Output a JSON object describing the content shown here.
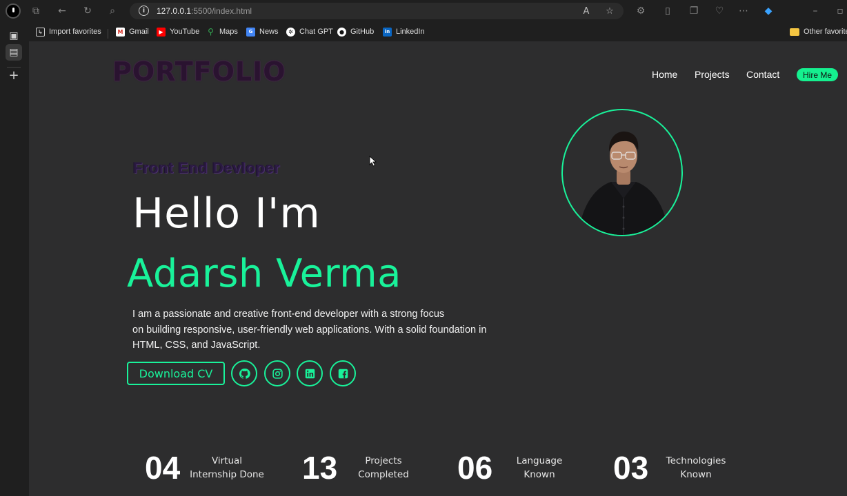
{
  "browser": {
    "url_host": "127.0.0.1",
    "url_rest": ":5500/index.html",
    "bookmarks": [
      {
        "label": "Import favorites",
        "icon": "import-icon"
      },
      {
        "label": "Gmail",
        "icon": "gmail-icon"
      },
      {
        "label": "YouTube",
        "icon": "youtube-icon"
      },
      {
        "label": "Maps",
        "icon": "maps-icon"
      },
      {
        "label": "News",
        "icon": "news-icon"
      },
      {
        "label": "Chat GPT",
        "icon": "chatgpt-icon"
      },
      {
        "label": "GitHub",
        "icon": "github-icon"
      },
      {
        "label": "LinkedIn",
        "icon": "linkedin-icon"
      }
    ],
    "other_favorites": "Other favorites"
  },
  "header": {
    "logo": "PORTFOLIO",
    "nav": [
      "Home",
      "Projects",
      "Contact"
    ],
    "hire_label": "Hire Me"
  },
  "hero": {
    "role": "Front End Devloper",
    "greeting": "Hello I'm",
    "name": "Adarsh Verma",
    "description_lines": [
      "I am a passionate and creative front-end developer with a strong focus",
      "on building responsive, user-friendly web applications. With a solid foundation in",
      "HTML, CSS, and JavaScript."
    ],
    "cv_label": "Download CV",
    "socials": [
      "github-icon",
      "instagram-icon",
      "linkedin-icon",
      "facebook-icon"
    ]
  },
  "stats": [
    {
      "number": "04",
      "label_lines": [
        "Virtual",
        "Internship Done"
      ]
    },
    {
      "number": "13",
      "label_lines": [
        "Projects",
        "Completed"
      ]
    },
    {
      "number": "06",
      "label_lines": [
        "Language",
        "Known"
      ]
    },
    {
      "number": "03",
      "label_lines": [
        "Technologies",
        "Known"
      ]
    }
  ],
  "colors": {
    "accent": "#19f29a",
    "page_bg": "#2d2d2e",
    "chrome_bg": "#1f1f1f"
  }
}
